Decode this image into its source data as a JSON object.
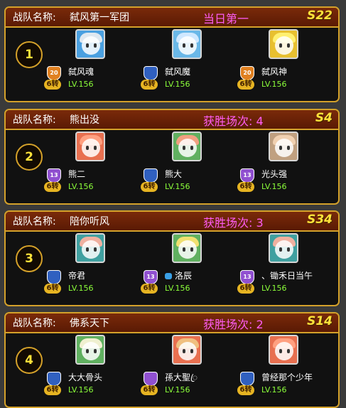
{
  "labels": {
    "team_label": "战队名称:"
  },
  "teams": [
    {
      "rank": "1",
      "name": "弑风第一军团",
      "status": "当日第一",
      "server": "S22",
      "members": [
        {
          "name": "弑风魂",
          "badge": "20",
          "turn": "6转",
          "level": "LV.156",
          "avatar_color": "#4aa0e0",
          "hair_color": "#dfe8f0",
          "badge_color": "#e08020"
        },
        {
          "name": "弑风魔",
          "badge": "",
          "turn": "6转",
          "level": "LV.156",
          "avatar_color": "#6ab8e8",
          "hair_color": "#cfe8ff",
          "badge_color": "#3060c0"
        },
        {
          "name": "弑风神",
          "badge": "20",
          "turn": "6转",
          "level": "LV.156",
          "avatar_color": "#e8c030",
          "hair_color": "#fff070",
          "badge_color": "#e08020"
        }
      ]
    },
    {
      "rank": "2",
      "name": "熊出没",
      "status": "获胜场次: 4",
      "server": "S4",
      "members": [
        {
          "name": "熊二",
          "badge": "13",
          "turn": "6转",
          "level": "LV.156",
          "avatar_color": "#e87050",
          "hair_color": "#ffa080",
          "badge_color": "#9050d0"
        },
        {
          "name": "熊大",
          "badge": "",
          "turn": "6转",
          "level": "LV.156",
          "avatar_color": "#60b060",
          "hair_color": "#f0a080",
          "badge_color": "#3060c0"
        },
        {
          "name": "光头强",
          "badge": "13",
          "turn": "6转",
          "level": "LV.156",
          "avatar_color": "#c0a080",
          "hair_color": "#f0d0b0",
          "badge_color": "#9050d0"
        }
      ]
    },
    {
      "rank": "3",
      "name": "陪你听风",
      "status": "获胜场次: 3",
      "server": "S34",
      "members": [
        {
          "name": "帝君",
          "badge": "",
          "turn": "6转",
          "level": "LV.156",
          "avatar_color": "#40a0a0",
          "hair_color": "#f0b0a0",
          "badge_color": "#3060c0"
        },
        {
          "name": "洛辰",
          "badge": "13",
          "turn": "6转",
          "level": "LV.156",
          "avatar_color": "#60b060",
          "hair_color": "#f0e070",
          "badge_color": "#9050d0"
        },
        {
          "name": "、锄禾日当午",
          "badge": "13",
          "turn": "6转",
          "level": "LV.156",
          "avatar_color": "#40a0a0",
          "hair_color": "#f0b0a0",
          "badge_color": "#9050d0"
        }
      ]
    },
    {
      "rank": "4",
      "name": "佛系天下",
      "status": "获胜场次: 2",
      "server": "S14",
      "members": [
        {
          "name": "大大骨头",
          "badge": "",
          "turn": "6转",
          "level": "LV.156",
          "avatar_color": "#60b060",
          "hair_color": "#f0f0d0",
          "badge_color": "#3060c0"
        },
        {
          "name": "孫大聖ꦿ",
          "badge": "",
          "turn": "6转",
          "level": "LV.156",
          "avatar_color": "#e87050",
          "hair_color": "#f0c080",
          "badge_color": "#9050d0"
        },
        {
          "name": "曾经那个少年",
          "badge": "",
          "turn": "6转",
          "level": "LV.156",
          "avatar_color": "#e87050",
          "hair_color": "#ffa080",
          "badge_color": "#3060c0"
        }
      ]
    }
  ]
}
